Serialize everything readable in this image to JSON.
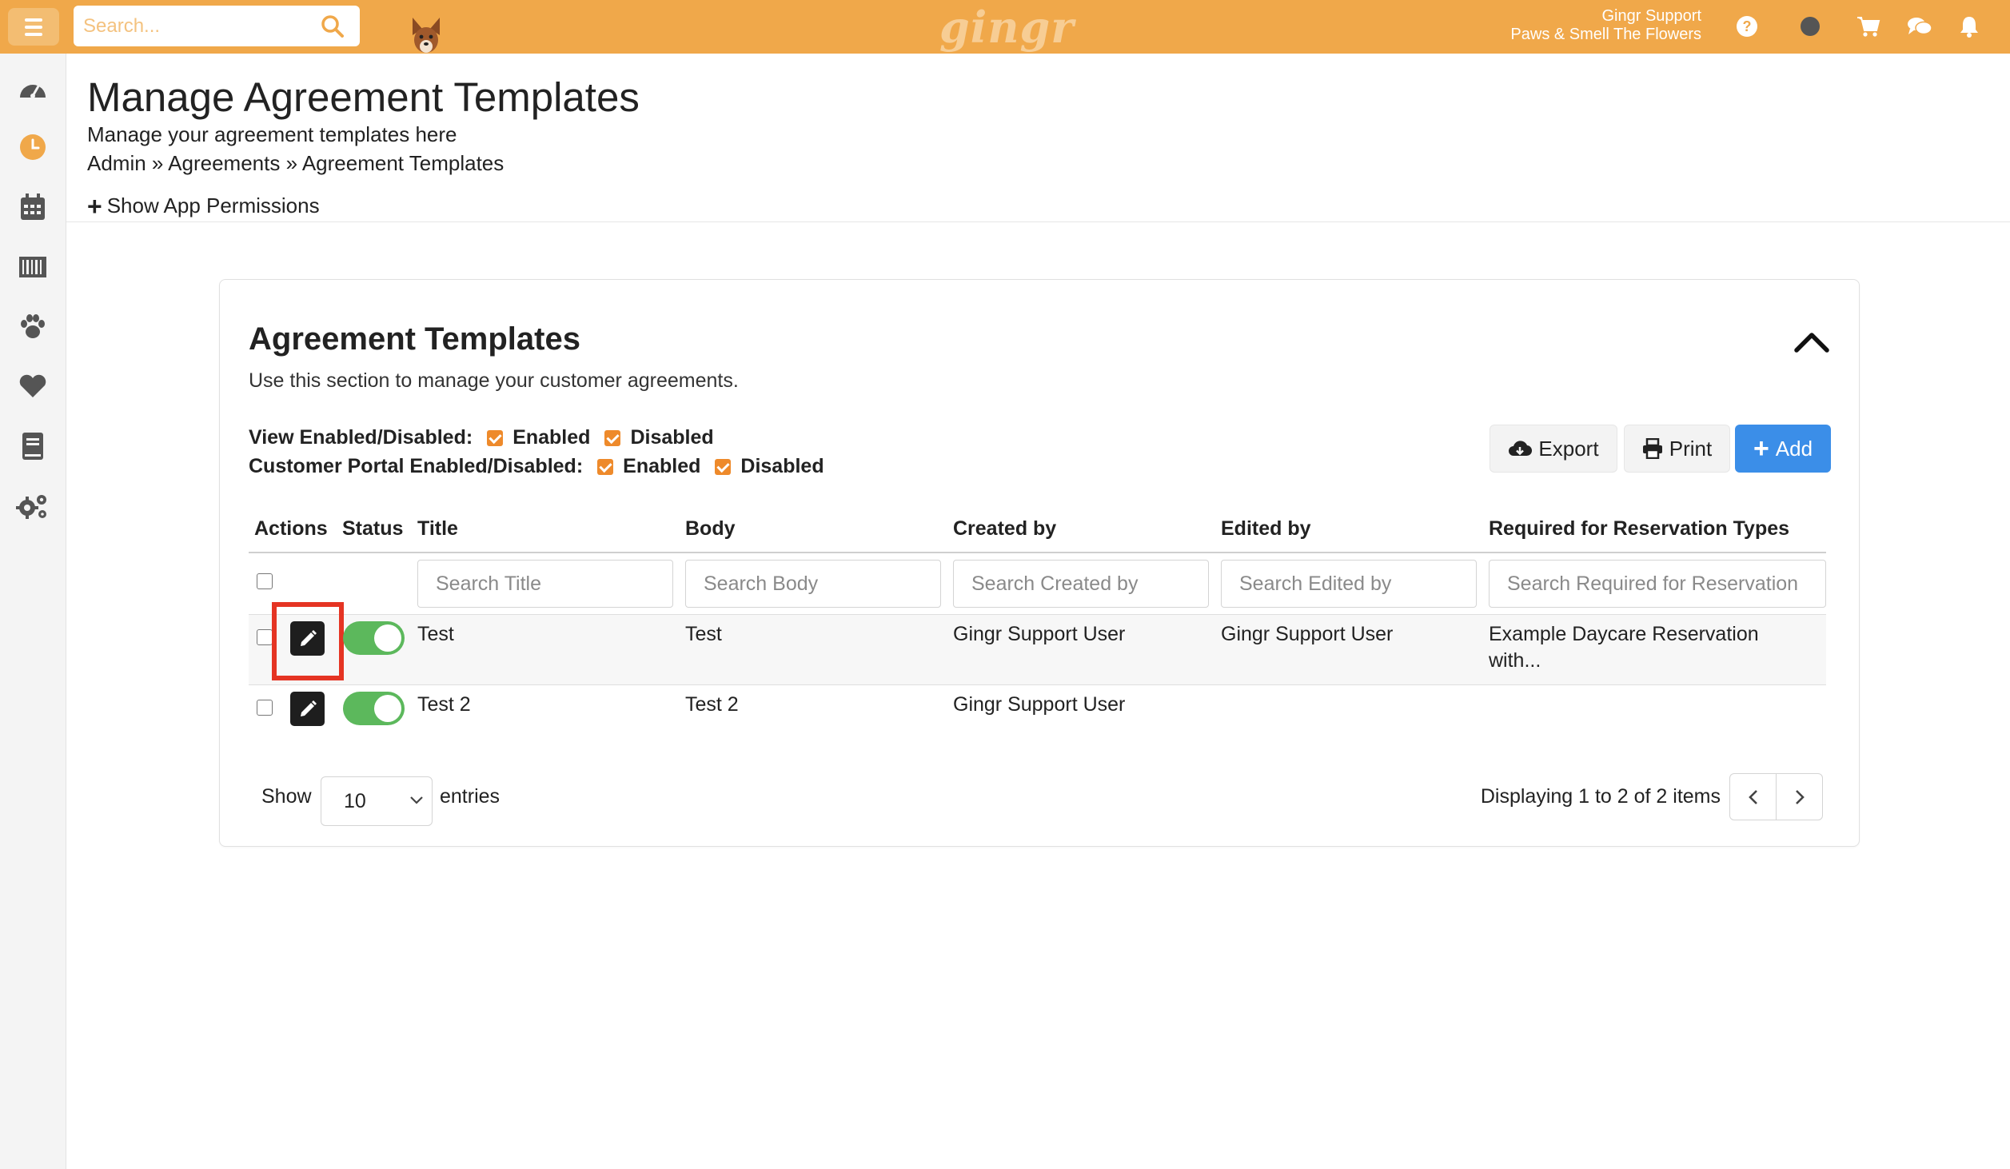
{
  "topbar": {
    "search_placeholder": "Search...",
    "brand": "gingr",
    "user_name": "Gingr Support",
    "location": "Paws & Smell The Flowers",
    "brand_color": "#f0a84a"
  },
  "sidebar": {
    "items": [
      {
        "icon": "dashboard-gauge-icon"
      },
      {
        "icon": "clock-icon"
      },
      {
        "icon": "calendar-icon"
      },
      {
        "icon": "barcode-icon"
      },
      {
        "icon": "paw-icon"
      },
      {
        "icon": "heart-icon"
      },
      {
        "icon": "book-icon"
      },
      {
        "icon": "settings-gears-icon"
      }
    ]
  },
  "page": {
    "title": "Manage Agreement Templates",
    "subtitle": "Manage your agreement templates here",
    "breadcrumb": "Admin » Agreements » Agreement Templates",
    "permissions_toggle": "Show App Permissions"
  },
  "card": {
    "title": "Agreement Templates",
    "description": "Use this section to manage your customer agreements.",
    "filters": {
      "view_label": "View Enabled/Disabled:",
      "portal_label": "Customer Portal Enabled/Disabled:",
      "enabled_label": "Enabled",
      "disabled_label": "Disabled"
    },
    "buttons": {
      "export": "Export",
      "print": "Print",
      "add": "Add"
    },
    "table": {
      "headers": {
        "actions": "Actions",
        "status": "Status",
        "title": "Title",
        "body": "Body",
        "created_by": "Created by",
        "edited_by": "Edited by",
        "required_for": "Required for Reservation Types"
      },
      "search_placeholders": {
        "title": "Search Title",
        "body": "Search Body",
        "created_by": "Search Created by",
        "edited_by": "Search Edited by",
        "required_for": "Search Required for Reservation"
      },
      "rows": [
        {
          "title": "Test",
          "body": "Test",
          "created_by": "Gingr Support User",
          "edited_by": "Gingr Support User",
          "required_for": "Example Daycare Reservation with...",
          "enabled": true
        },
        {
          "title": "Test 2",
          "body": "Test 2",
          "created_by": "Gingr Support User",
          "edited_by": "",
          "required_for": "",
          "enabled": true
        }
      ]
    },
    "footer": {
      "show_label": "Show",
      "page_size": "10",
      "entries_label": "entries",
      "displaying": "Displaying 1 to 2 of 2 items"
    }
  },
  "colors": {
    "primary_button": "#3b8ee8",
    "toggle_on": "#5cb85c",
    "checkbox_orange": "#ee8a2b",
    "highlight": "#e53423"
  }
}
